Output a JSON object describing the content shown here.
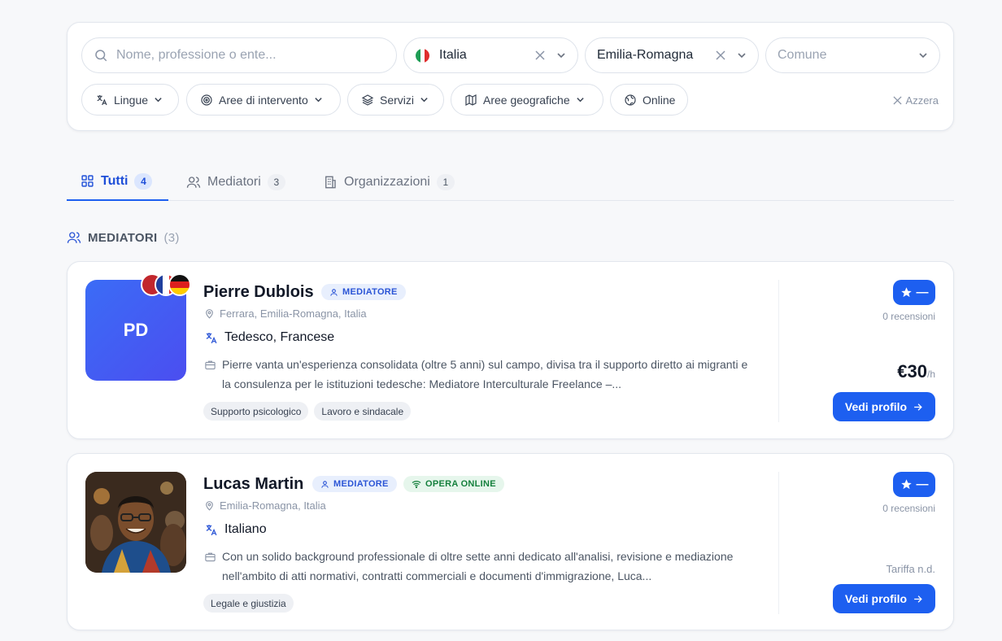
{
  "filters": {
    "search_placeholder": "Nome, professione o ente...",
    "country": "Italia",
    "region": "Emilia-Romagna",
    "comune_placeholder": "Comune",
    "chips": [
      "Lingue",
      "Aree di intervento",
      "Servizi",
      "Aree geografiche",
      "Online"
    ],
    "reset": "Azzera"
  },
  "tabs": [
    {
      "label": "Tutti",
      "count": "4"
    },
    {
      "label": "Mediatori",
      "count": "3"
    },
    {
      "label": "Organizzazioni",
      "count": "1"
    }
  ],
  "section": {
    "title": "MEDIATORI",
    "count": "(3)"
  },
  "cards": [
    {
      "initials": "PD",
      "name": "Pierre Dublois",
      "badge": "MEDIATORE",
      "location": "Ferrara, Emilia-Romagna, Italia",
      "languages": "Tedesco, Francese",
      "description": "Pierre vanta un'esperienza consolidata (oltre 5 anni) sul campo, divisa tra il supporto diretto ai migranti e la consulenza per le istituzioni tedesche: Mediatore Interculturale Freelance –...",
      "tags": [
        "Supporto psicologico",
        "Lavoro e sindacale"
      ],
      "rating": "—",
      "reviews": "0 recensioni",
      "price": "€30",
      "price_unit": "/h",
      "cta": "Vedi profilo"
    },
    {
      "name": "Lucas Martin",
      "badge": "MEDIATORE",
      "badge_online": "OPERA ONLINE",
      "location": "Emilia-Romagna, Italia",
      "languages": "Italiano",
      "description": "Con un solido background professionale di oltre sette anni dedicato all'analisi, revisione e mediazione nell'ambito di atti normativi, contratti commerciali e documenti d'immigrazione, Luca...",
      "tags": [
        "Legale e giustizia"
      ],
      "rating": "—",
      "reviews": "0 recensioni",
      "rate_na": "Tariffa n.d.",
      "cta": "Vedi profilo"
    }
  ],
  "colors": {
    "accent": "#1d5ff0",
    "online": "#15803d"
  }
}
